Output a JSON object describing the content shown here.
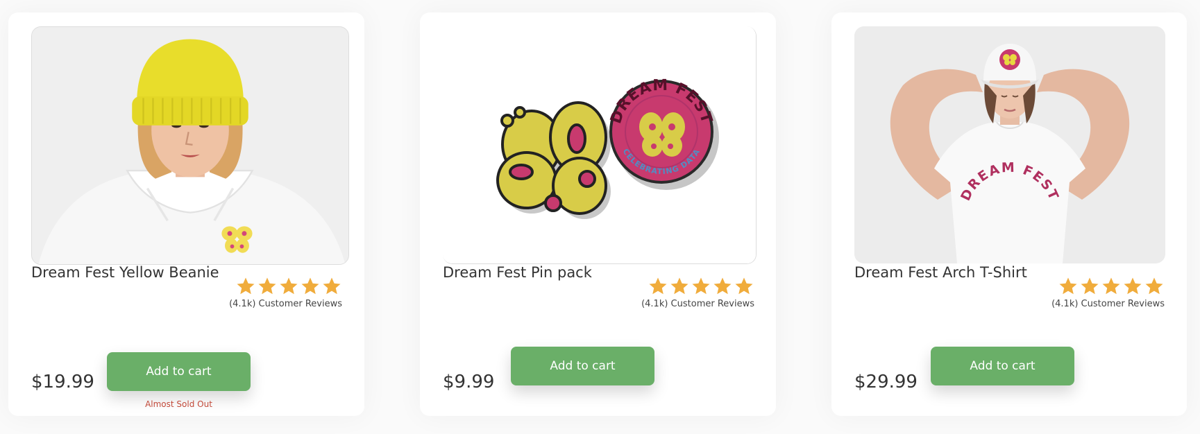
{
  "colors": {
    "accent_button": "#6aaf68",
    "star": "#f0ac3c",
    "alert": "#c24a3a",
    "brand_pink": "#c83a6e",
    "brand_yellow": "#d8cc48"
  },
  "products": [
    {
      "title": "Dream Fest Yellow Beanie",
      "rating": 5,
      "reviews": "(4.1k) Customer Reviews",
      "price": "$19.99",
      "cta": "Add to cart",
      "stock_note": "Almost Sold Out",
      "image_icon": "beanie-model-photo"
    },
    {
      "title": "Dream Fest Pin pack",
      "rating": 5,
      "reviews": "(4.1k) Customer Reviews",
      "price": "$9.99",
      "cta": "Add to cart",
      "image_icon": "enamel-pins-photo",
      "pin_text_top": "DREAM FEST",
      "pin_text_bottom": "CELEBRATING DATA"
    },
    {
      "title": "Dream Fest Arch T-Shirt",
      "rating": 5,
      "reviews": "(4.1k) Customer Reviews",
      "price": "$29.99",
      "cta": "Add to cart",
      "image_icon": "tshirt-model-photo",
      "shirt_text": "DREAM FEST"
    }
  ]
}
